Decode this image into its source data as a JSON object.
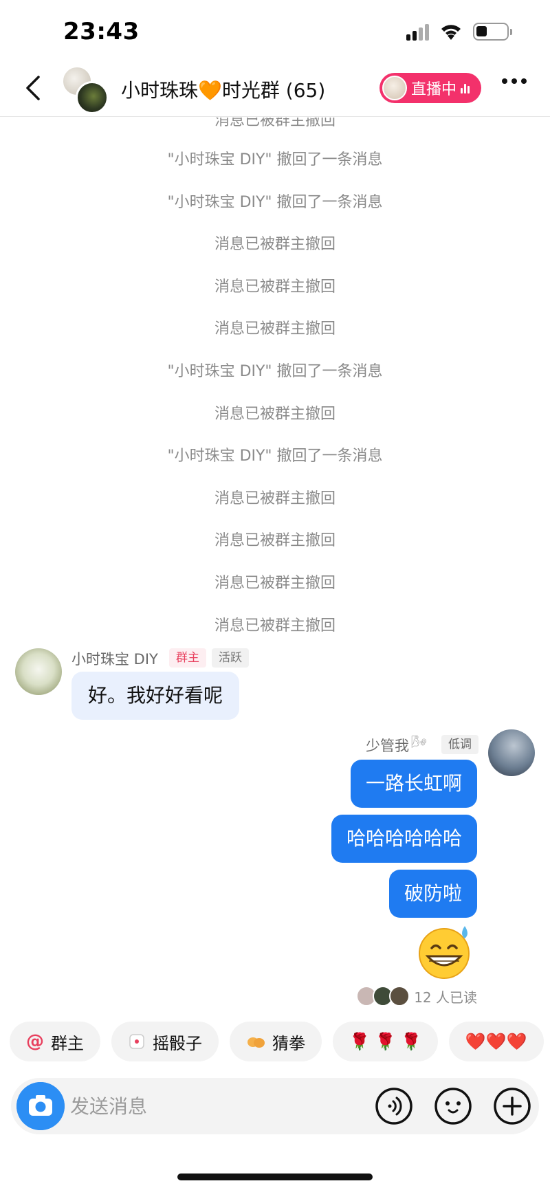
{
  "status_bar": {
    "time": "23:43"
  },
  "header": {
    "title": "小时珠珠🧡时光群 (65)",
    "live_label": "直播中"
  },
  "messages": {
    "partial_top": "消息已被群主撤回",
    "system": [
      "\"小时珠宝 DIY\" 撤回了一条消息",
      "\"小时珠宝 DIY\" 撤回了一条消息",
      "消息已被群主撤回",
      "消息已被群主撤回",
      "消息已被群主撤回",
      "\"小时珠宝 DIY\" 撤回了一条消息",
      "消息已被群主撤回",
      "\"小时珠宝 DIY\" 撤回了一条消息",
      "消息已被群主撤回",
      "消息已被群主撤回",
      "消息已被群主撤回",
      "消息已被群主撤回"
    ],
    "incoming": {
      "sender": "小时珠宝 DIY",
      "badge_owner": "群主",
      "badge_active": "活跃",
      "text": "好。我好好看呢"
    },
    "outgoing": {
      "sender": "少管我",
      "sender_emoji": "🌬",
      "badge": "低调",
      "bubbles": [
        "一路长虹啊",
        "哈哈哈哈哈哈",
        "破防啦"
      ],
      "sticker": "grinning-sweat-emoji",
      "read_receipt": "12 人已读"
    }
  },
  "quick_actions": [
    {
      "icon": "@",
      "label": "群主"
    },
    {
      "icon": "dice-icon",
      "label": "摇骰子"
    },
    {
      "icon": "fist-icon",
      "label": "猜拳"
    },
    {
      "icon": "rose-icon",
      "label": "🌹 🌹 🌹"
    },
    {
      "icon": "heart-icon",
      "label": "❤️❤️❤️"
    }
  ],
  "input_bar": {
    "placeholder": "发送消息"
  },
  "colors": {
    "accent_blue": "#1f7bf1",
    "live_pink": "#f3316b",
    "incoming_bubble": "#e9f0fd",
    "system_text": "#8a8a8a"
  }
}
